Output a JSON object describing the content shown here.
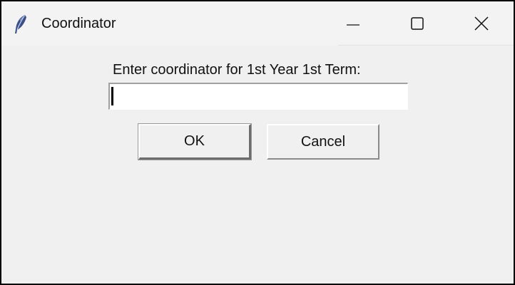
{
  "window": {
    "title": "Coordinator",
    "app_icon": "feather-icon",
    "controls": [
      "minimize-icon",
      "maximize-icon",
      "close-icon"
    ]
  },
  "dialog": {
    "prompt": "Enter coordinator for 1st Year 1st Term:",
    "entry_value": "",
    "ok_label": "OK",
    "cancel_label": "Cancel"
  },
  "colors": {
    "window_bg": "#f0f0f0",
    "titlebar_bg": "#f3f3f3",
    "entry_bg": "#ffffff",
    "text": "#111111"
  }
}
